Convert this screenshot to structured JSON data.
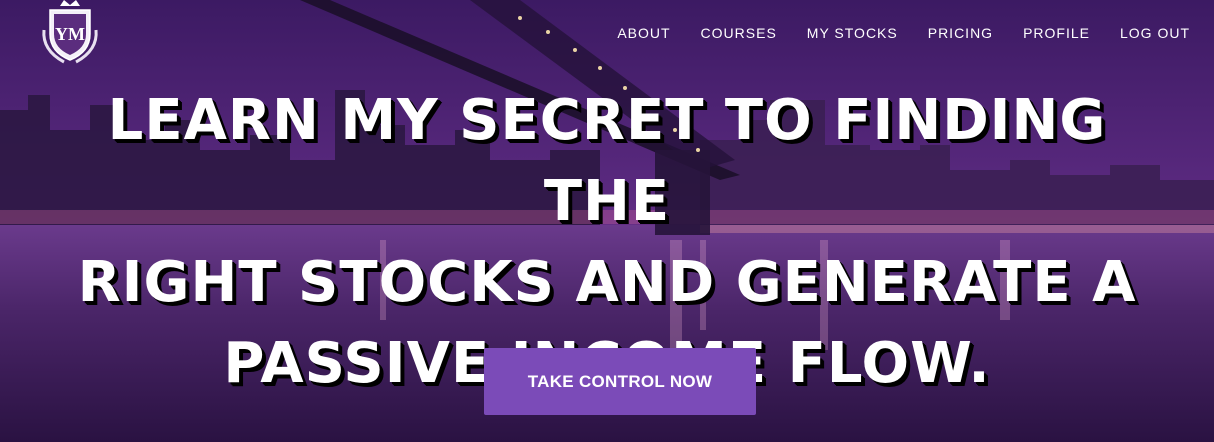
{
  "brand": {
    "logo_icon": "crest-logo-icon",
    "monogram": "YM"
  },
  "nav": {
    "items": [
      {
        "label": "ABOUT"
      },
      {
        "label": "COURSES"
      },
      {
        "label": "MY STOCKS"
      },
      {
        "label": "PRICING"
      },
      {
        "label": "PROFILE"
      },
      {
        "label": "LOG OUT"
      }
    ]
  },
  "hero": {
    "headline_lines": [
      "LEARN MY SECRET TO FINDING THE",
      "RIGHT STOCKS AND GENERATE A",
      "PASSIVE INCOME FLOW."
    ],
    "cta_label": "TAKE CONTROL NOW",
    "background": "night-city-bridge-image"
  },
  "colors": {
    "cta": "#7b4bb8",
    "overlay": "#4a2470",
    "text": "#ffffff"
  }
}
